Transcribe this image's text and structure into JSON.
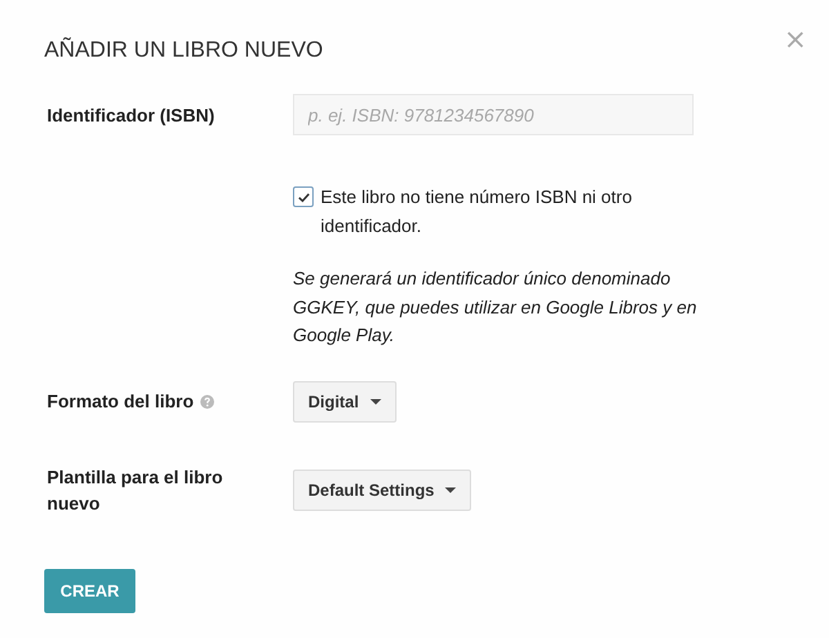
{
  "dialog": {
    "title": "AÑADIR UN LIBRO NUEVO",
    "close": "×"
  },
  "isbn": {
    "label": "Identificador (ISBN)",
    "placeholder": "p. ej. ISBN: 9781234567890"
  },
  "no_isbn": {
    "label": "Este libro no tiene número ISBN ni otro identificador.",
    "checked": true
  },
  "note": "Se generará un identificador único denominado GGKEY, que puedes utilizar en Google Libros y en Google Play.",
  "format": {
    "label": "Formato del libro",
    "value": "Digital"
  },
  "template": {
    "label": "Plantilla para el libro nuevo",
    "value": "Default Settings"
  },
  "submit": "CREAR"
}
